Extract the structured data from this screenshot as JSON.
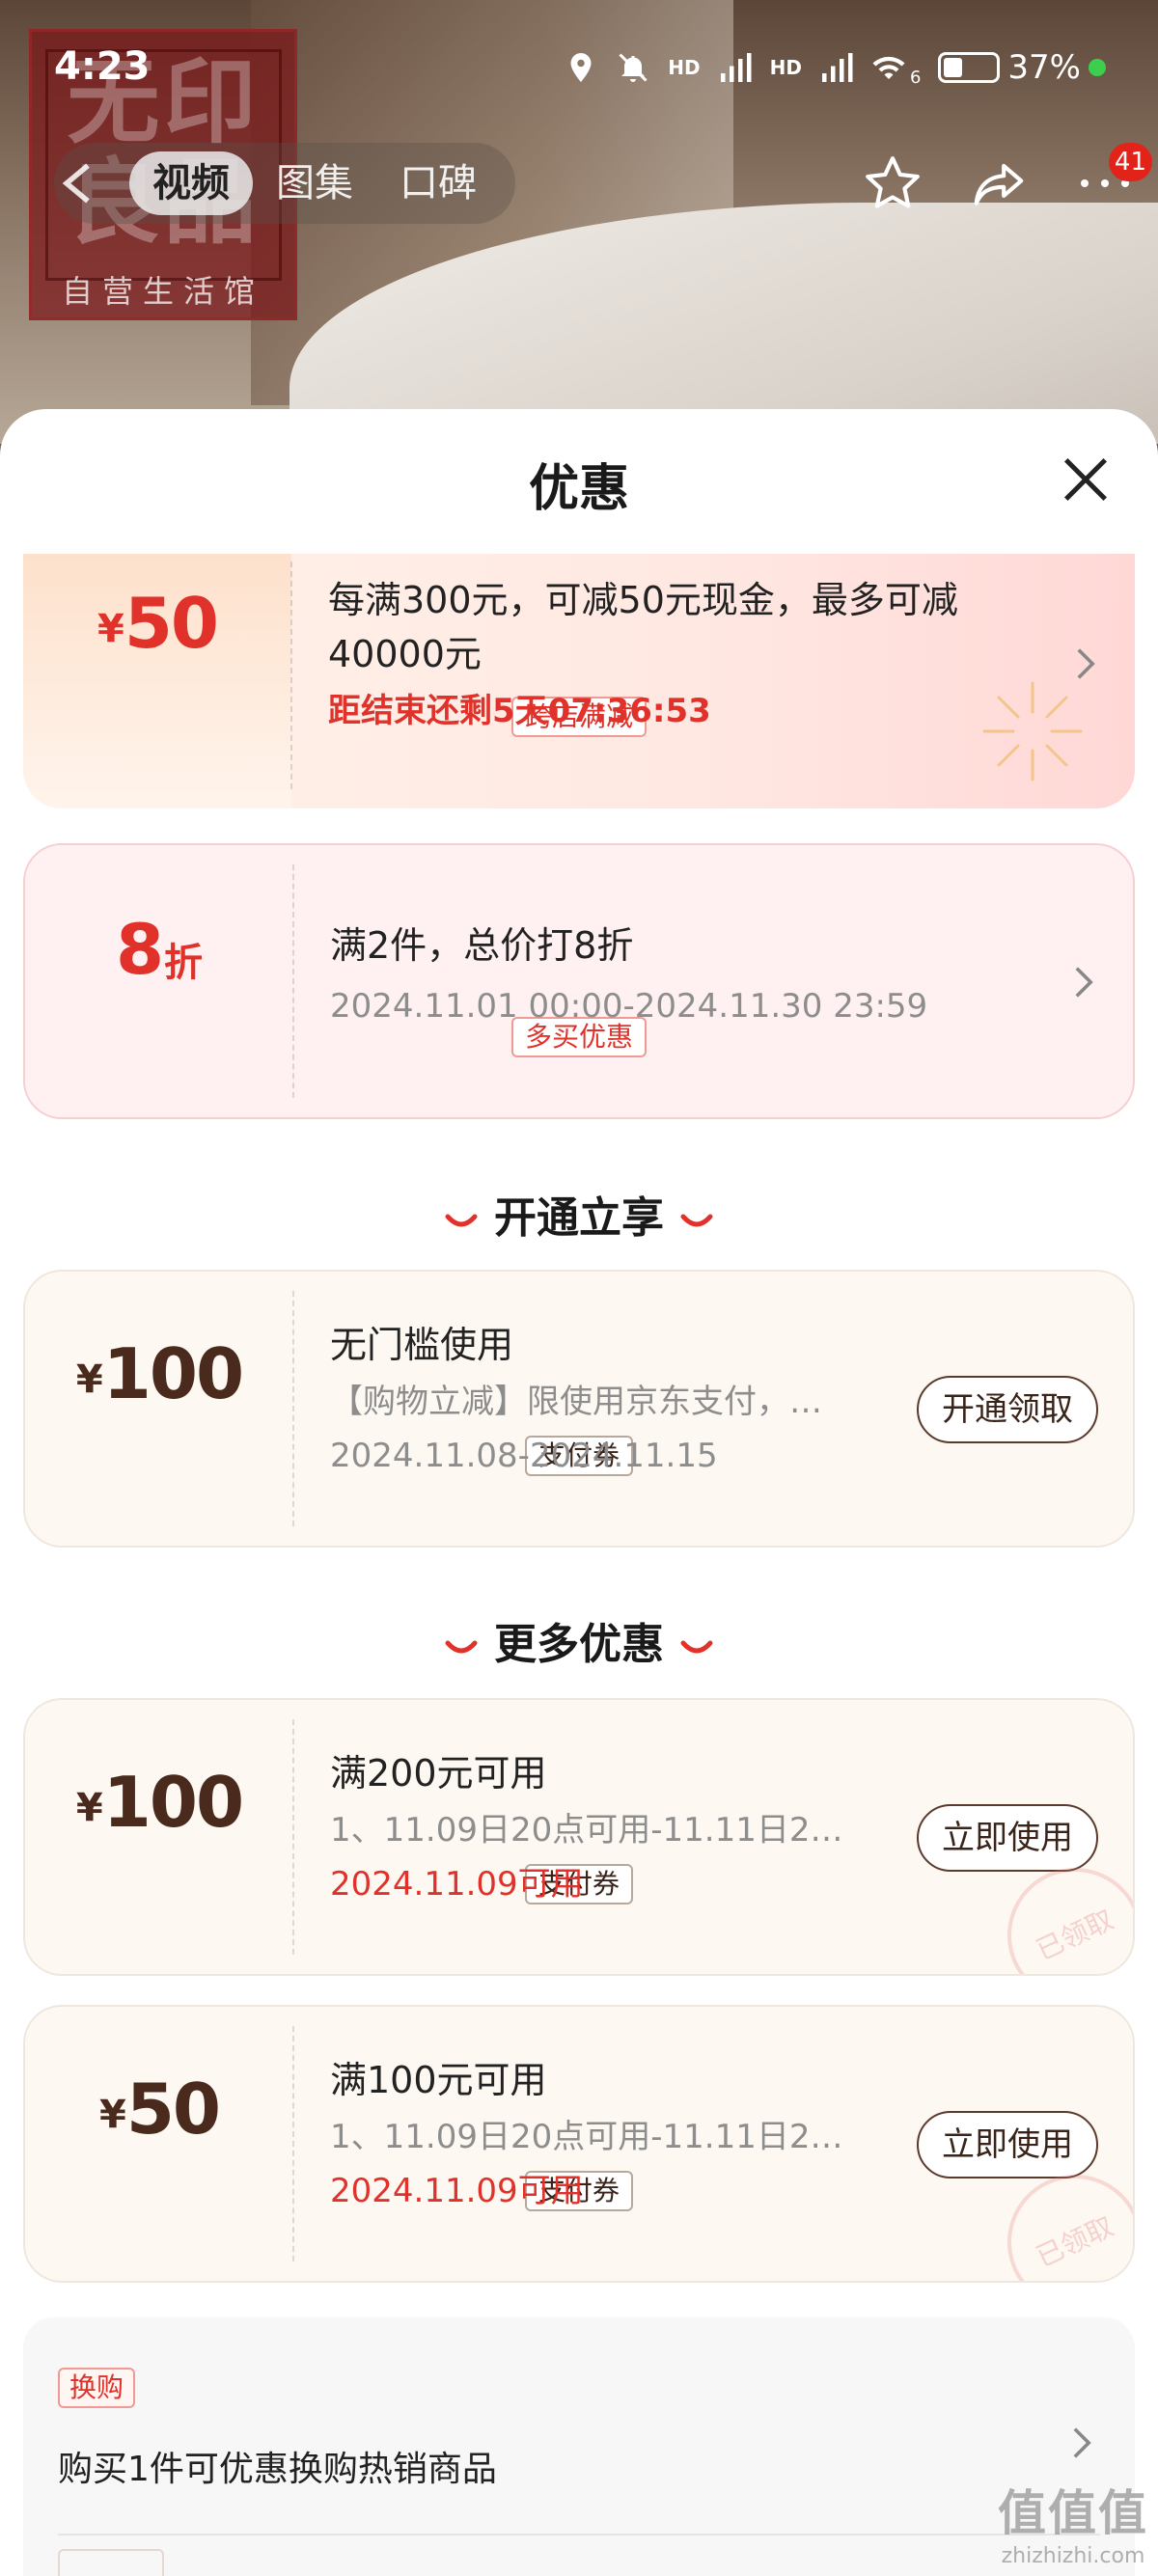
{
  "status_bar": {
    "time": "4:23",
    "network_1": "HD",
    "network_2": "HD",
    "wifi_level": "6",
    "battery_percent": "37%",
    "battery_level": 0.37
  },
  "hero": {
    "brand_main": "无印良品",
    "brand_sub": "自营生活馆"
  },
  "header_tabs": [
    "视频",
    "图集",
    "口碑"
  ],
  "header_actions": {
    "message_badge": "41"
  },
  "sheet": {
    "title": "优惠"
  },
  "promos": [
    {
      "yen": "¥",
      "amount": "50",
      "tag": "跨店满减",
      "line1": "每满300元，可减50元现金，最多可减40000元",
      "countdown": "距结束还剩5天07:36:53"
    },
    {
      "amount": "8",
      "unit": "折",
      "tag": "多买优惠",
      "line1": "满2件，总价打8折",
      "period": "2024.11.01 00:00-2024.11.30 23:59"
    }
  ],
  "section_open": {
    "title": "开通立享"
  },
  "open_coupon": {
    "yen": "¥",
    "amount": "100",
    "tag": "支付券",
    "line1": "无门槛使用",
    "line2": "【购物立减】限使用京东支付，核...",
    "period": "2024.11.08-2024.11.15",
    "button": "开通领取"
  },
  "section_more": {
    "title": "更多优惠"
  },
  "more_coupons": [
    {
      "yen": "¥",
      "amount": "100",
      "tag": "支付券",
      "line1": "满200元可用",
      "line2": "1、11.09日20点可用-11.11日24点...",
      "date": "2024.11.09可用",
      "button": "立即使用",
      "stamp": "已领取"
    },
    {
      "yen": "¥",
      "amount": "50",
      "tag": "支付券",
      "line1": "满100元可用",
      "line2": "1、11.09日20点可用-11.11日24点...",
      "date": "2024.11.09可用",
      "button": "立即使用",
      "stamp": "已领取"
    }
  ],
  "swap": {
    "tag": "换购",
    "text": "购买1件可优惠换购热销商品"
  },
  "watermark": {
    "main": "值值值",
    "sub": "zhizhizhi.com"
  },
  "colors": {
    "accent_red": "#e0322a",
    "brown": "#4a2a1c",
    "cream": "#fdf8f2"
  }
}
